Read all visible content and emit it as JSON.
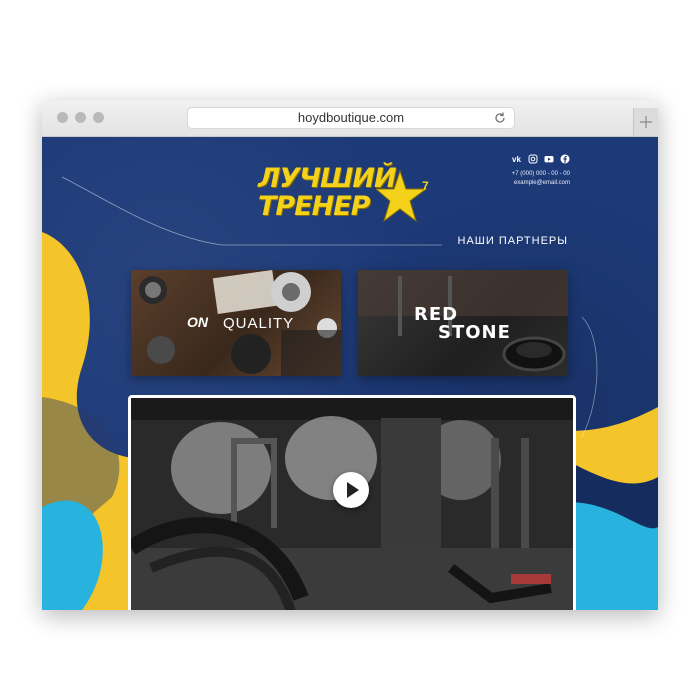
{
  "browser": {
    "url": "hoydboutique.com",
    "icons": [
      "close-dot-icon",
      "minimize-dot-icon",
      "zoom-dot-icon",
      "reload-icon",
      "new-tab-plus-icon"
    ]
  },
  "header": {
    "logo_line1": "ЛУЧШИЙ",
    "logo_line2": "ТРЕНЕР",
    "logo_number": "7",
    "socials": [
      "vk-icon",
      "instagram-icon",
      "youtube-icon",
      "facebook-icon"
    ],
    "phone": "+7 (000) 000 - 00 - 00",
    "email": "example@email.com"
  },
  "partners": {
    "title": "НАШИ ПАРТНЕРЫ",
    "items": [
      {
        "badge": "ON",
        "label": "QUALITY"
      },
      {
        "line1": "RED",
        "line2": "STONE"
      }
    ]
  },
  "video": {
    "icon": "play-icon"
  },
  "colors": {
    "navy": "#1d3a78",
    "yellow": "#f4c52a",
    "cyan": "#27b3dd",
    "logo_yellow": "#f4d21a"
  }
}
